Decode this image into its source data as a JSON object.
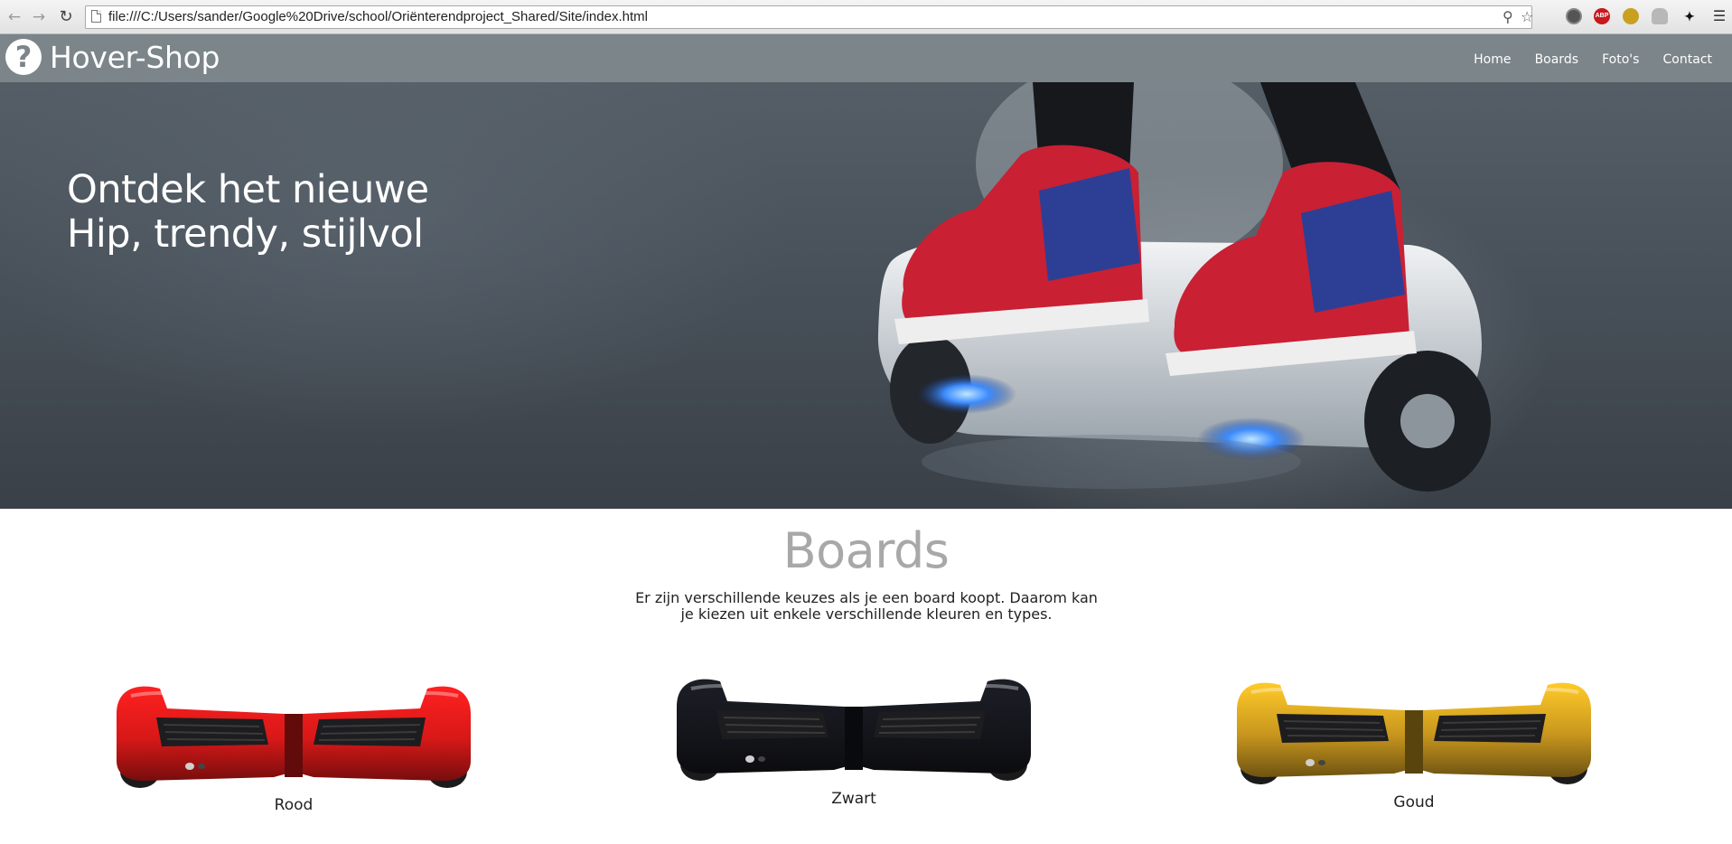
{
  "browser": {
    "url": "file:///C:/Users/sander/Google%20Drive/school/Oriënterendproject_Shared/Site/index.html",
    "extensions": [
      "opera-icon",
      "adblock-plus-icon",
      "gold-extension-icon",
      "cloud-extension-icon",
      "cursor-extension-icon"
    ],
    "adblock_label": "ABP"
  },
  "site": {
    "logo_glyph": "?",
    "brand": "Hover-Shop",
    "nav": [
      "Home",
      "Boards",
      "Foto's",
      "Contact"
    ]
  },
  "hero": {
    "line1": "Ontdek het nieuwe",
    "line2": "Hip, trendy, stijlvol"
  },
  "boards": {
    "title": "Boards",
    "description": "Er zijn verschillende keuzes als je een board koopt. Daarom kan je kiezen uit enkele verschillende kleuren en types.",
    "items": [
      {
        "label": "Rood",
        "color": "#d81818"
      },
      {
        "label": "Zwart",
        "color": "#15161c"
      },
      {
        "label": "Goud",
        "color": "#c8961e"
      }
    ]
  }
}
